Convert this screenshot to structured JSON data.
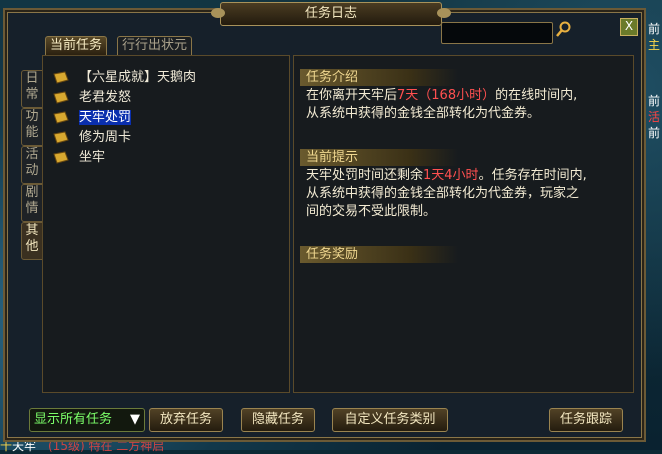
{
  "window": {
    "title": "任务日志"
  },
  "top_tabs": [
    {
      "label": "当前任务"
    },
    {
      "label": "行行出状元"
    }
  ],
  "side_tabs": [
    {
      "label": "日常"
    },
    {
      "label": "功能"
    },
    {
      "label": "活动"
    },
    {
      "label": "剧情"
    },
    {
      "label": "其他"
    }
  ],
  "quests": [
    {
      "label": "【六星成就】天鹅肉"
    },
    {
      "label": "老君发怒"
    },
    {
      "label": "天牢处罚",
      "selected": true
    },
    {
      "label": "修为周卡"
    },
    {
      "label": "坐牢"
    }
  ],
  "detail": {
    "intro_header": "任务介绍",
    "intro_line1_a": "在你离开天牢后",
    "intro_line1_b": "7天（168小时）",
    "intro_line1_c": "的在线时间内,",
    "intro_line2": "从系统中获得的金钱全部转化为代金券。",
    "hint_header": "当前提示",
    "hint_line1_a": "天牢处罚时间还剩余",
    "hint_line1_b": "1天4小时",
    "hint_line1_c": "。任务存在时间内,",
    "hint_line2": "从系统中获得的金钱全部转化为代金券，玩家之",
    "hint_line3": "间的交易不受此限制。",
    "reward_header": "任务奖励"
  },
  "buttons": {
    "show_all": "显示所有任务",
    "abandon": "放弃任务",
    "hide": "隐藏任务",
    "custom": "自定义任务类别",
    "track": "任务跟踪"
  },
  "close_label": "X",
  "bg_text": {
    "right_col": [
      "前",
      "主",
      "前",
      "活",
      "前"
    ],
    "bottom": "天牢",
    "bottom_left": "十",
    "bottom_mid": "(15级) 特在 二方神启"
  },
  "colors": {
    "selected_bg": "#0a2fae",
    "highlight": "#ff5050",
    "show_all": "#7cff6a"
  }
}
